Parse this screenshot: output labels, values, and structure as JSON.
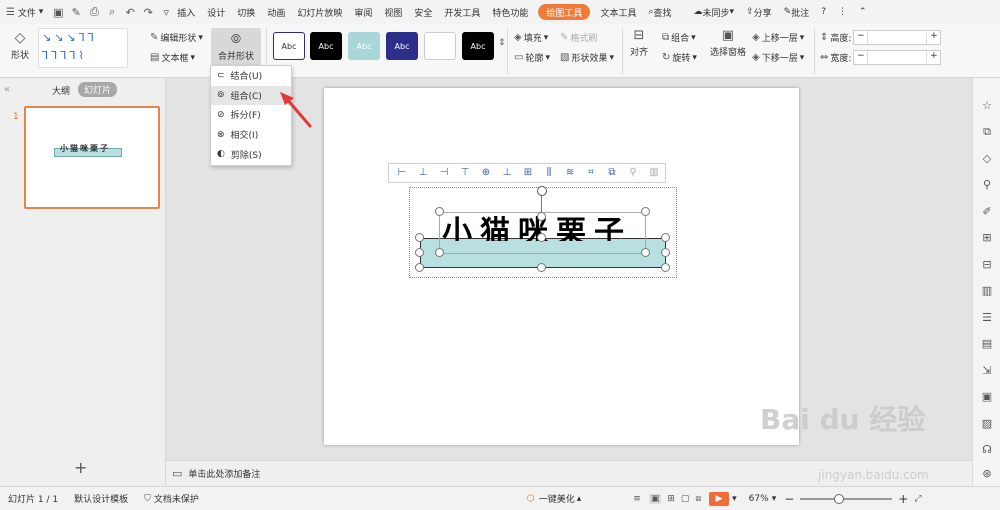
{
  "menubar": {
    "menu": "文件",
    "tabs": [
      "插入",
      "设计",
      "切换",
      "动画",
      "幻灯片放映",
      "审阅",
      "视图",
      "安全",
      "开发工具",
      "特色功能",
      "绘图工具",
      "文本工具"
    ],
    "active_tab": "绘图工具",
    "search": "查找",
    "sync": "未同步",
    "share": "分享",
    "comment": "批注",
    "help": "?"
  },
  "ribbon": {
    "shape_label": "形状",
    "edit_shape": "编辑形状",
    "text_box": "文本框",
    "merge_shape": "合并形状",
    "style_boxes": [
      "Abc",
      "Abc",
      "Abc",
      "Abc",
      "",
      "Abc"
    ],
    "fill": "填充",
    "format_painter": "格式刷",
    "outline": "轮廓",
    "shape_effect": "形状效果",
    "align": "对齐",
    "group": "组合",
    "rotate": "旋转",
    "selection_pane": "选择窗格",
    "bring_forward": "上移一层",
    "send_backward": "下移一层",
    "height_label": "高度:",
    "width_label": "宽度:",
    "minus": "−",
    "plus": "+"
  },
  "dropdown": {
    "items": [
      "结合(U)",
      "组合(C)",
      "拆分(F)",
      "相交(I)",
      "剪除(S)"
    ],
    "highlighted": 1
  },
  "left_panel": {
    "tab_outline": "大纲",
    "tab_slides": "幻灯片",
    "slide_number": "1",
    "add": "+",
    "collapse": "«",
    "thumb_text": "小猫咪栗子"
  },
  "slide": {
    "title_text": "小猫咪栗子",
    "rect_color": "#b9e0e0"
  },
  "notes": {
    "placeholder": "单击此处添加备注"
  },
  "status": {
    "slide_info": "幻灯片 1 / 1",
    "template": "默认设计模板",
    "doc_protect": "文档未保护",
    "beautify": "一键美化",
    "zoom": "67%",
    "minus": "−",
    "plus": "+"
  },
  "watermark": {
    "brand": "Bai du 经验",
    "url": "jingyan.baidu.com"
  }
}
